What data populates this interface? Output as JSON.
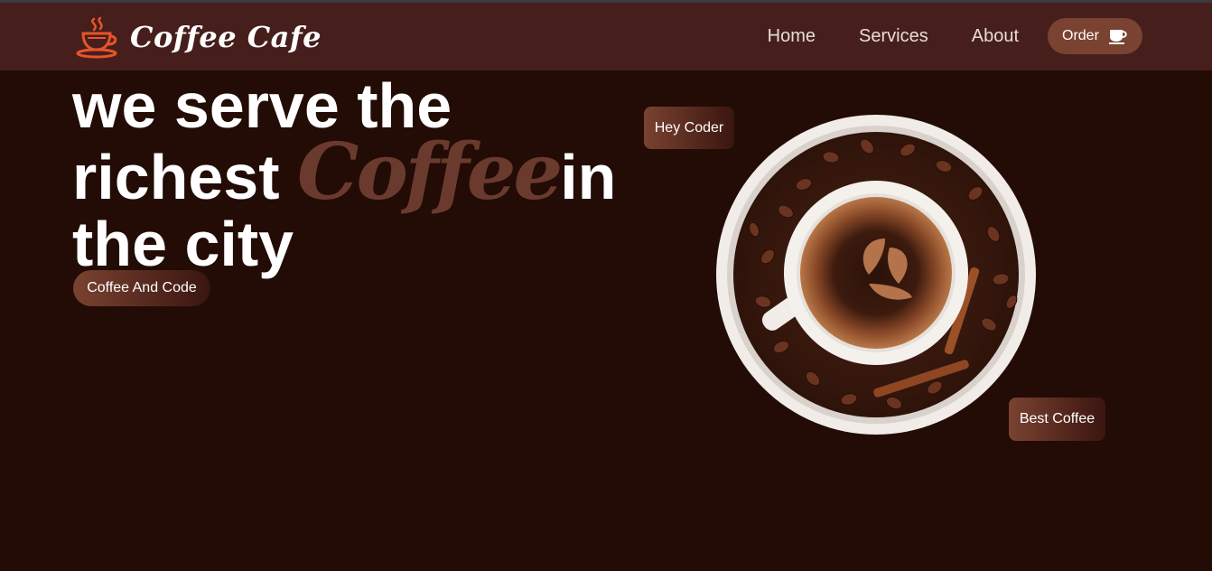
{
  "header": {
    "brand_name": "Coffee Cafe",
    "brand_icon": "coffee-cup-icon",
    "nav": [
      "Home",
      "Services",
      "About"
    ],
    "order_label": "Order",
    "order_icon": "cup-icon"
  },
  "hero": {
    "line1": "we serve the",
    "line2_start": "richest ",
    "accent": "Coffee",
    "line2_end": "in",
    "line3": "the city",
    "cta": "Coffee And Code"
  },
  "badges": {
    "hey": "Hey Coder",
    "best": "Best Coffee"
  },
  "colors": {
    "background": "#220c05",
    "header": "#461f1d",
    "accent": "#6b3a2e",
    "button": "#7a4231",
    "logo": "#e8542a"
  }
}
